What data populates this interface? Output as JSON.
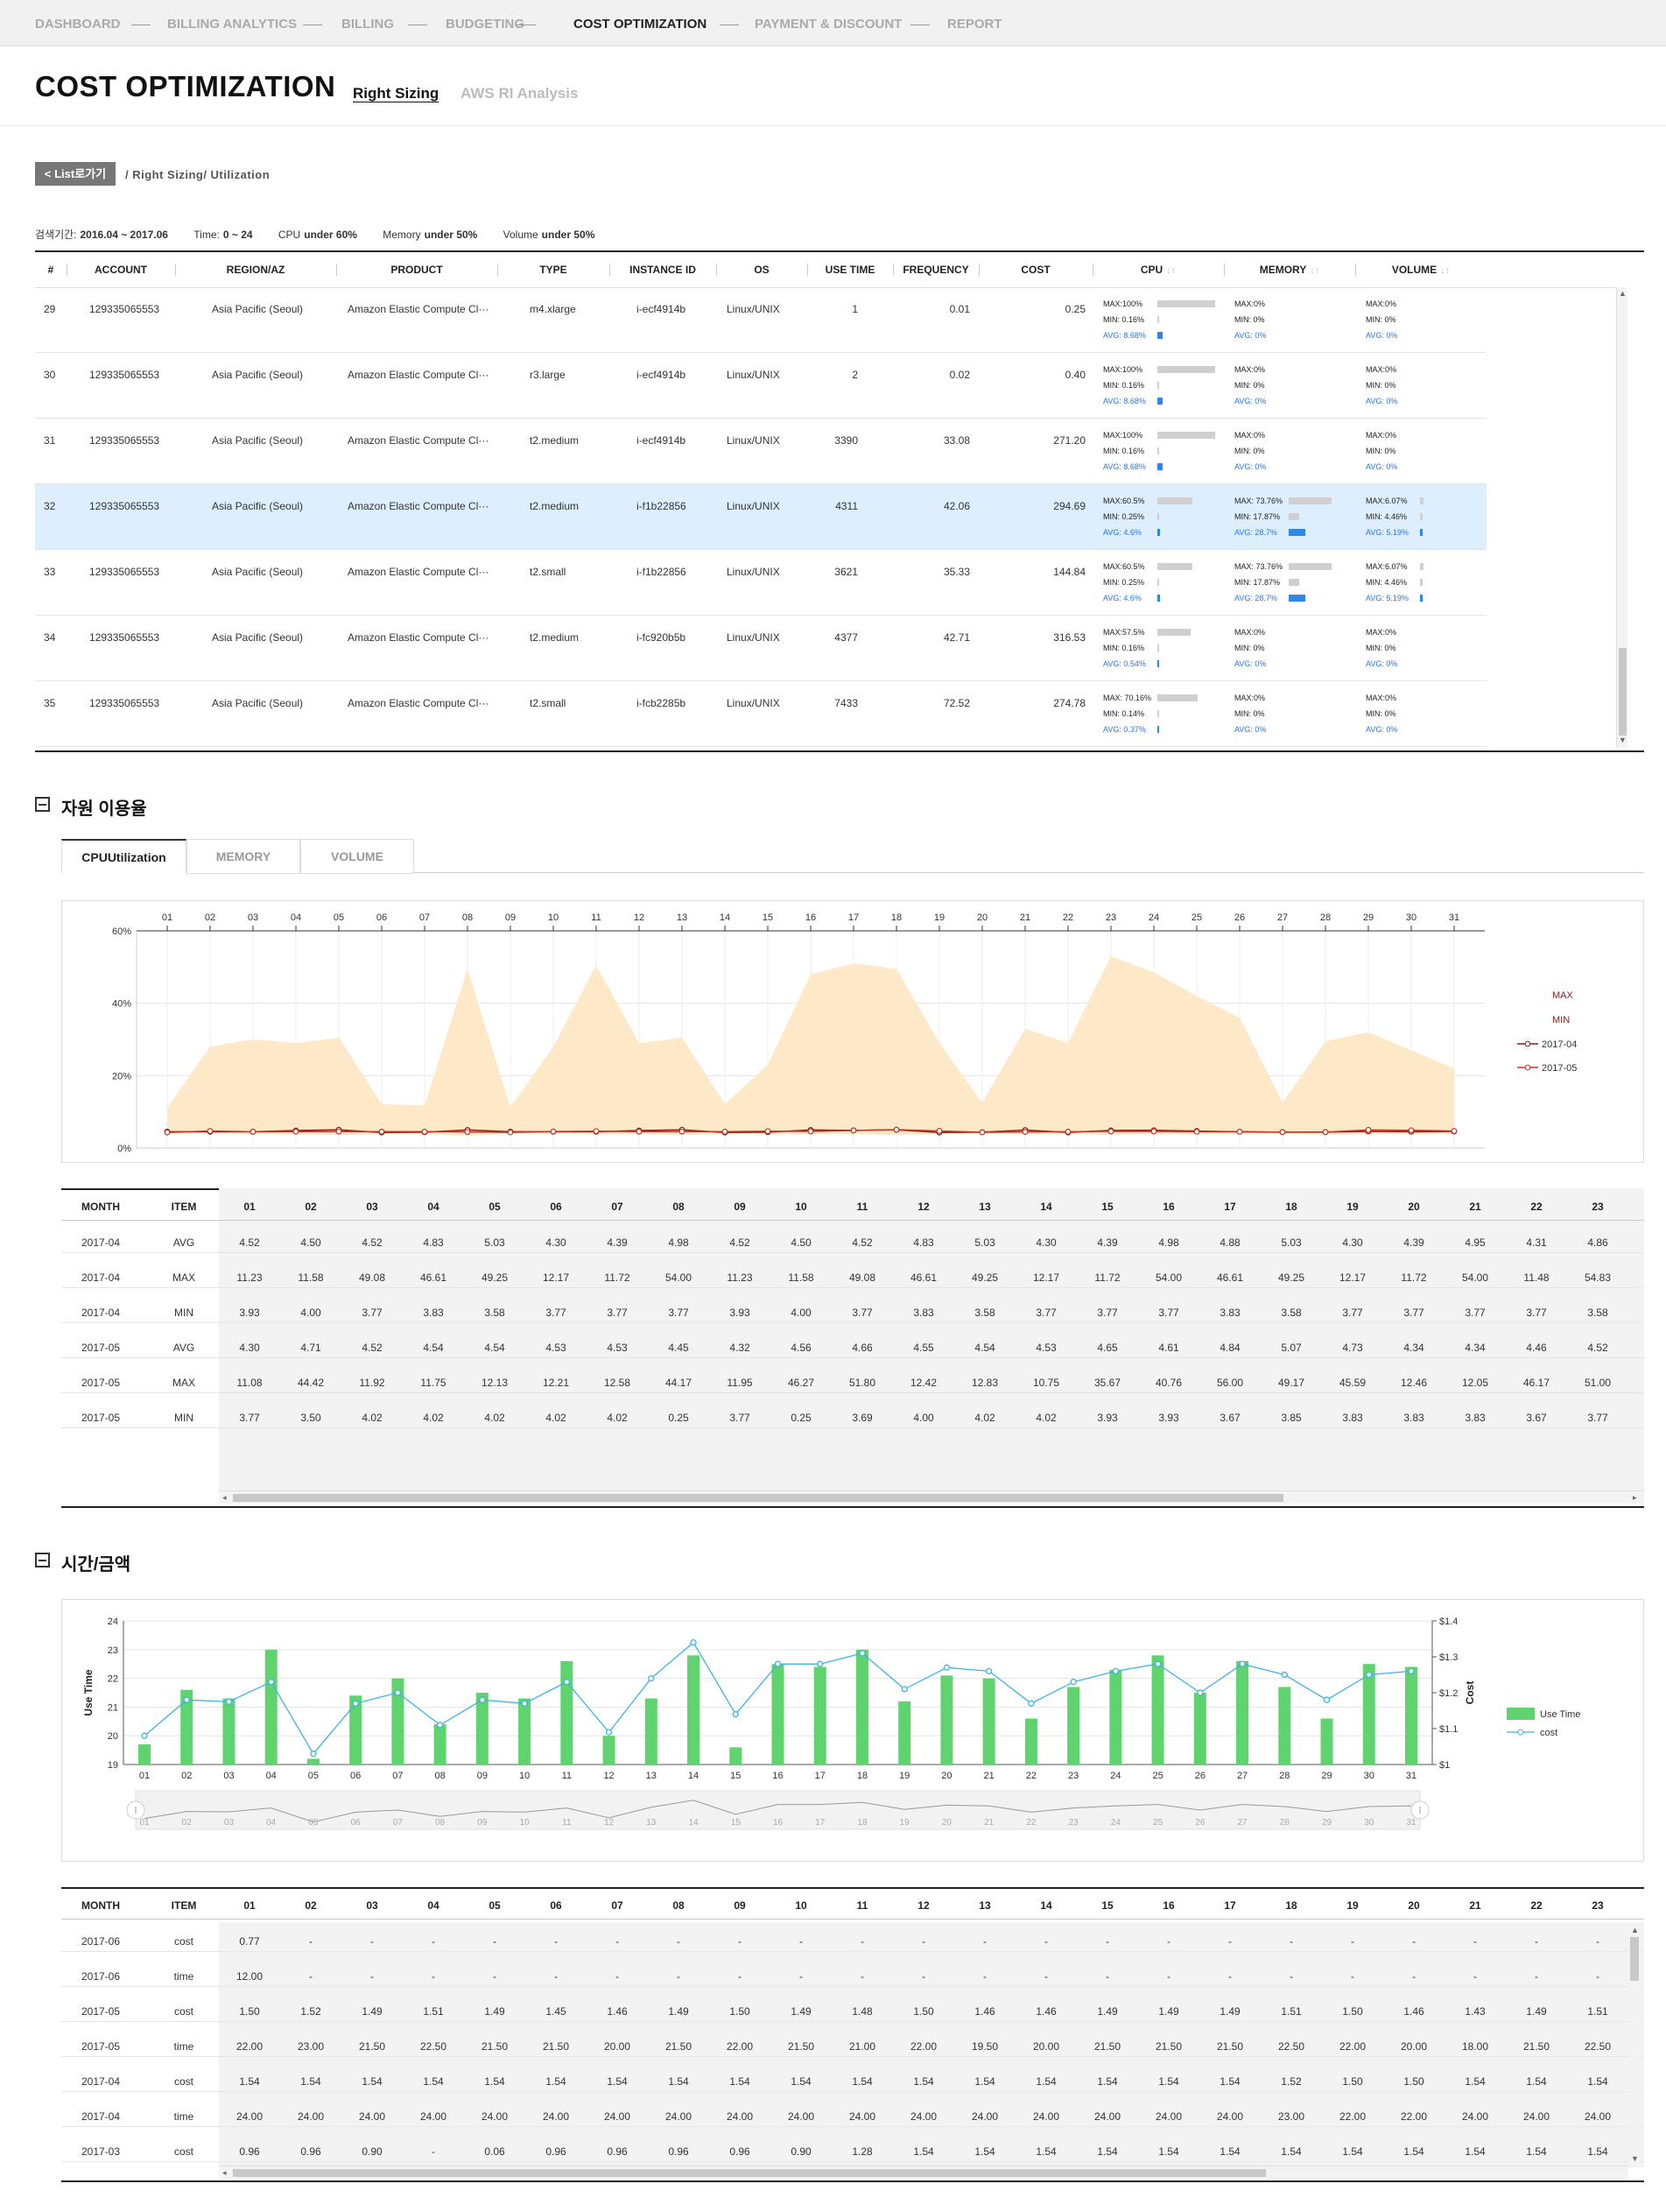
{
  "nav": {
    "items": [
      "DASHBOARD",
      "BILLING ANALYTICS",
      "BILLING",
      "BUDGETING",
      "COST OPTIMIZATION",
      "PAYMENT & DISCOUNT",
      "REPORT"
    ],
    "active_index": 4
  },
  "page": {
    "title": "COST OPTIMIZATION",
    "subtabs": [
      "Right Sizing",
      "AWS RI Analysis"
    ],
    "active_subtab": 0,
    "back_label": "< List로가기",
    "breadcrumb": "/ Right Sizing/ Utilization"
  },
  "filters": [
    {
      "label": "검색기간:",
      "value": "2016.04 ~ 2017.06"
    },
    {
      "label": "Time:",
      "value": "0 ~ 24"
    },
    {
      "label": "CPU",
      "value": "under 60%"
    },
    {
      "label": "Memory",
      "value": "under 50%"
    },
    {
      "label": "Volume",
      "value": "under 50%"
    }
  ],
  "instance_table": {
    "headers": [
      "#",
      "ACCOUNT",
      "REGION/AZ",
      "PRODUCT",
      "TYPE",
      "INSTANCE ID",
      "OS",
      "USE TIME",
      "FREQUENCY",
      "COST",
      "CPU",
      "MEMORY",
      "VOLUME"
    ],
    "sort_glyph": "↓↑",
    "selected_row": 3,
    "rows": [
      {
        "no": "29",
        "account": "129335065553",
        "region": "Asia Pacific (Seoul)",
        "product": "Amazon Elastic Compute Cl···",
        "type": "m4.xlarge",
        "instance": "i-ecf4914b",
        "os": "Linux/UNIX",
        "use_time": "1",
        "frequency": "0.01",
        "cost": "0.25",
        "cpu": {
          "max": "MAX:100%",
          "min": "MIN: 0.16%",
          "avg": "AVG: 8.68%",
          "max_v": 100,
          "min_v": 0.16,
          "avg_v": 8.68
        },
        "memory": {
          "max": "MAX:0%",
          "min": "MIN: 0%",
          "avg": "AVG: 0%",
          "max_v": 0,
          "min_v": 0,
          "avg_v": 0
        },
        "volume": {
          "max": "MAX:0%",
          "min": "MIN: 0%",
          "avg": "AVG: 0%",
          "max_v": 0,
          "min_v": 0,
          "avg_v": 0
        }
      },
      {
        "no": "30",
        "account": "129335065553",
        "region": "Asia Pacific (Seoul)",
        "product": "Amazon Elastic Compute Cl···",
        "type": "r3.large",
        "instance": "i-ecf4914b",
        "os": "Linux/UNIX",
        "use_time": "2",
        "frequency": "0.02",
        "cost": "0.40",
        "cpu": {
          "max": "MAX:100%",
          "min": "MIN: 0.16%",
          "avg": "AVG: 8.68%",
          "max_v": 100,
          "min_v": 0.16,
          "avg_v": 8.68
        },
        "memory": {
          "max": "MAX:0%",
          "min": "MIN: 0%",
          "avg": "AVG: 0%",
          "max_v": 0,
          "min_v": 0,
          "avg_v": 0
        },
        "volume": {
          "max": "MAX:0%",
          "min": "MIN: 0%",
          "avg": "AVG: 0%",
          "max_v": 0,
          "min_v": 0,
          "avg_v": 0
        }
      },
      {
        "no": "31",
        "account": "129335065553",
        "region": "Asia Pacific (Seoul)",
        "product": "Amazon Elastic Compute Cl···",
        "type": "t2.medium",
        "instance": "i-ecf4914b",
        "os": "Linux/UNIX",
        "use_time": "3390",
        "frequency": "33.08",
        "cost": "271.20",
        "cpu": {
          "max": "MAX:100%",
          "min": "MIN: 0.16%",
          "avg": "AVG: 8.68%",
          "max_v": 100,
          "min_v": 0.16,
          "avg_v": 8.68
        },
        "memory": {
          "max": "MAX:0%",
          "min": "MIN: 0%",
          "avg": "AVG: 0%",
          "max_v": 0,
          "min_v": 0,
          "avg_v": 0
        },
        "volume": {
          "max": "MAX:0%",
          "min": "MIN: 0%",
          "avg": "AVG: 0%",
          "max_v": 0,
          "min_v": 0,
          "avg_v": 0
        }
      },
      {
        "no": "32",
        "account": "129335065553",
        "region": "Asia Pacific (Seoul)",
        "product": "Amazon Elastic Compute Cl···",
        "type": "t2.medium",
        "instance": "i-f1b22856",
        "os": "Linux/UNIX",
        "use_time": "4311",
        "frequency": "42.06",
        "cost": "294.69",
        "cpu": {
          "max": "MAX:60.5%",
          "min": "MIN: 0.25%",
          "avg": "AVG: 4.6%",
          "max_v": 60.5,
          "min_v": 0.25,
          "avg_v": 4.6
        },
        "memory": {
          "max": "MAX: 73.76%",
          "min": "MIN: 17.87%",
          "avg": "AVG: 28.7%",
          "max_v": 73.76,
          "min_v": 17.87,
          "avg_v": 28.7
        },
        "volume": {
          "max": "MAX:6.07%",
          "min": "MIN: 4.46%",
          "avg": "AVG: 5.19%",
          "max_v": 6.07,
          "min_v": 4.46,
          "avg_v": 5.19
        }
      },
      {
        "no": "33",
        "account": "129335065553",
        "region": "Asia Pacific (Seoul)",
        "product": "Amazon Elastic Compute Cl···",
        "type": "t2.small",
        "instance": "i-f1b22856",
        "os": "Linux/UNIX",
        "use_time": "3621",
        "frequency": "35.33",
        "cost": "144.84",
        "cpu": {
          "max": "MAX:60.5%",
          "min": "MIN: 0.25%",
          "avg": "AVG: 4.6%",
          "max_v": 60.5,
          "min_v": 0.25,
          "avg_v": 4.6
        },
        "memory": {
          "max": "MAX: 73.76%",
          "min": "MIN: 17.87%",
          "avg": "AVG: 28.7%",
          "max_v": 73.76,
          "min_v": 17.87,
          "avg_v": 28.7
        },
        "volume": {
          "max": "MAX:6.07%",
          "min": "MIN: 4.46%",
          "avg": "AVG: 5.19%",
          "max_v": 6.07,
          "min_v": 4.46,
          "avg_v": 5.19
        }
      },
      {
        "no": "34",
        "account": "129335065553",
        "region": "Asia Pacific (Seoul)",
        "product": "Amazon Elastic Compute Cl···",
        "type": "t2.medium",
        "instance": "i-fc920b5b",
        "os": "Linux/UNIX",
        "use_time": "4377",
        "frequency": "42.71",
        "cost": "316.53",
        "cpu": {
          "max": "MAX:57.5%",
          "min": "MIN: 0.16%",
          "avg": "AVG: 0.54%",
          "max_v": 57.5,
          "min_v": 0.16,
          "avg_v": 0.54
        },
        "memory": {
          "max": "MAX:0%",
          "min": "MIN: 0%",
          "avg": "AVG: 0%",
          "max_v": 0,
          "min_v": 0,
          "avg_v": 0
        },
        "volume": {
          "max": "MAX:0%",
          "min": "MIN: 0%",
          "avg": "AVG: 0%",
          "max_v": 0,
          "min_v": 0,
          "avg_v": 0
        }
      },
      {
        "no": "35",
        "account": "129335065553",
        "region": "Asia Pacific (Seoul)",
        "product": "Amazon Elastic Compute Cl···",
        "type": "t2.small",
        "instance": "i-fcb2285b",
        "os": "Linux/UNIX",
        "use_time": "7433",
        "frequency": "72.52",
        "cost": "274.78",
        "cpu": {
          "max": "MAX: 70.16%",
          "min": "MIN: 0.14%",
          "avg": "AVG: 0.37%",
          "max_v": 70.16,
          "min_v": 0.14,
          "avg_v": 0.37
        },
        "memory": {
          "max": "MAX:0%",
          "min": "MIN: 0%",
          "avg": "AVG: 0%",
          "max_v": 0,
          "min_v": 0,
          "avg_v": 0
        },
        "volume": {
          "max": "MAX:0%",
          "min": "MIN: 0%",
          "avg": "AVG: 0%",
          "max_v": 0,
          "min_v": 0,
          "avg_v": 0
        }
      }
    ]
  },
  "usage_section": {
    "title": "자원 이용율",
    "tabs": [
      "CPUUtilization",
      "MEMORY",
      "VOLUME"
    ],
    "active_tab": 0
  },
  "time_cost_section": {
    "title": "시간/금액"
  },
  "chart_data": [
    {
      "type": "area",
      "x": [
        "01",
        "02",
        "03",
        "04",
        "05",
        "06",
        "07",
        "08",
        "09",
        "10",
        "11",
        "12",
        "13",
        "14",
        "15",
        "16",
        "17",
        "18",
        "19",
        "20",
        "21",
        "22",
        "23",
        "24",
        "25",
        "26",
        "27",
        "28",
        "29",
        "30",
        "31"
      ],
      "ylim": [
        0,
        60
      ],
      "yticks": [
        "0%",
        "20%",
        "40%",
        "60%"
      ],
      "grid": true,
      "legend": [
        "MAX",
        "MIN",
        "2017-04",
        "2017-05"
      ],
      "legend_position": "right",
      "series": [
        {
          "name": "MAX",
          "values": [
            11.23,
            28,
            30,
            29,
            30.5,
            12.17,
            11.72,
            49.5,
            11.23,
            28,
            50.5,
            29,
            30.5,
            12.17,
            23,
            48,
            51,
            49.5,
            29,
            12.5,
            33,
            29,
            53,
            48.5,
            42,
            36,
            12.5,
            29.5,
            32,
            27,
            22
          ]
        },
        {
          "name": "MIN",
          "values": [
            3.9,
            4.0,
            3.8,
            3.8,
            3.6,
            3.8,
            3.8,
            3.4,
            3.9,
            4.0,
            3.8,
            3.8,
            3.6,
            3.8,
            3.8,
            3.8,
            3.8,
            3.6,
            3.8,
            3.8,
            3.8,
            3.8,
            3.6,
            3.8,
            3.8,
            3.8,
            3.8,
            3.6,
            3.8,
            3.8,
            3.8
          ]
        },
        {
          "name": "2017-04",
          "values": [
            4.52,
            4.5,
            4.52,
            4.83,
            5.03,
            4.3,
            4.39,
            4.98,
            4.52,
            4.5,
            4.52,
            4.83,
            5.03,
            4.3,
            4.39,
            4.98,
            4.88,
            5.03,
            4.3,
            4.39,
            4.95,
            4.31,
            4.86,
            4.9,
            4.7,
            4.5,
            4.4,
            4.4,
            4.6,
            4.5,
            4.6
          ]
        },
        {
          "name": "2017-05",
          "values": [
            4.3,
            4.71,
            4.52,
            4.54,
            4.54,
            4.53,
            4.53,
            4.45,
            4.32,
            4.56,
            4.66,
            4.55,
            4.54,
            4.53,
            4.65,
            4.61,
            4.84,
            5.07,
            4.73,
            4.34,
            4.46,
            4.52,
            4.6,
            4.6,
            4.5,
            4.5,
            4.4,
            4.4,
            5.0,
            4.9,
            4.7
          ]
        }
      ]
    },
    {
      "type": "bar",
      "x": [
        "01",
        "02",
        "03",
        "04",
        "05",
        "06",
        "07",
        "08",
        "09",
        "10",
        "11",
        "12",
        "13",
        "14",
        "15",
        "16",
        "17",
        "18",
        "19",
        "20",
        "21",
        "22",
        "23",
        "24",
        "25",
        "26",
        "27",
        "28",
        "29",
        "30",
        "31"
      ],
      "ylabel": "Use Time",
      "y2label": "Cost",
      "ylim": [
        19,
        24
      ],
      "y2lim": [
        1.0,
        1.4
      ],
      "y2ticks": [
        "$1",
        "$1.1",
        "$1.2",
        "$1.3",
        "$1.4"
      ],
      "grid": true,
      "legend": [
        "Use Time",
        "cost"
      ],
      "legend_position": "right",
      "series": [
        {
          "name": "Use Time",
          "axis": "left",
          "values": [
            19.7,
            21.6,
            21.3,
            23.0,
            19.2,
            21.4,
            22.0,
            20.4,
            21.5,
            21.3,
            22.6,
            20.0,
            21.3,
            22.8,
            19.6,
            22.5,
            22.4,
            23.0,
            21.2,
            22.1,
            22.0,
            20.6,
            21.7,
            22.3,
            22.8,
            21.5,
            22.6,
            21.7,
            20.6,
            22.5,
            22.4
          ]
        },
        {
          "name": "cost",
          "axis": "right",
          "values": [
            1.08,
            1.18,
            1.175,
            1.23,
            1.03,
            1.17,
            1.2,
            1.11,
            1.18,
            1.17,
            1.23,
            1.09,
            1.24,
            1.34,
            1.14,
            1.28,
            1.28,
            1.31,
            1.21,
            1.27,
            1.26,
            1.17,
            1.23,
            1.26,
            1.28,
            1.2,
            1.28,
            1.25,
            1.18,
            1.25,
            1.26
          ]
        }
      ]
    }
  ],
  "usage_table": {
    "headers": [
      "MONTH",
      "ITEM",
      "01",
      "02",
      "03",
      "04",
      "05",
      "06",
      "07",
      "08",
      "09",
      "10",
      "11",
      "12",
      "13",
      "14",
      "15",
      "16",
      "17",
      "18",
      "19",
      "20",
      "21",
      "22",
      "23"
    ],
    "rows": [
      [
        "2017-04",
        "AVG",
        "4.52",
        "4.50",
        "4.52",
        "4.83",
        "5.03",
        "4.30",
        "4.39",
        "4.98",
        "4.52",
        "4.50",
        "4.52",
        "4.83",
        "5.03",
        "4.30",
        "4.39",
        "4.98",
        "4.88",
        "5.03",
        "4.30",
        "4.39",
        "4.95",
        "4.31",
        "4.86"
      ],
      [
        "2017-04",
        "MAX",
        "11.23",
        "11.58",
        "49.08",
        "46.61",
        "49.25",
        "12.17",
        "11.72",
        "54.00",
        "11.23",
        "11.58",
        "49.08",
        "46.61",
        "49.25",
        "12.17",
        "11.72",
        "54.00",
        "46.61",
        "49.25",
        "12.17",
        "11.72",
        "54.00",
        "11.48",
        "54.83"
      ],
      [
        "2017-04",
        "MIN",
        "3.93",
        "4.00",
        "3.77",
        "3.83",
        "3.58",
        "3.77",
        "3.77",
        "3.77",
        "3.93",
        "4.00",
        "3.77",
        "3.83",
        "3.58",
        "3.77",
        "3.77",
        "3.77",
        "3.83",
        "3.58",
        "3.77",
        "3.77",
        "3.77",
        "3.77",
        "3.58"
      ],
      [
        "2017-05",
        "AVG",
        "4.30",
        "4.71",
        "4.52",
        "4.54",
        "4.54",
        "4.53",
        "4.53",
        "4.45",
        "4.32",
        "4.56",
        "4.66",
        "4.55",
        "4.54",
        "4.53",
        "4.65",
        "4.61",
        "4.84",
        "5.07",
        "4.73",
        "4.34",
        "4.34",
        "4.46",
        "4.52"
      ],
      [
        "2017-05",
        "MAX",
        "11.08",
        "44.42",
        "11.92",
        "11.75",
        "12.13",
        "12.21",
        "12.58",
        "44.17",
        "11.95",
        "46.27",
        "51.80",
        "12.42",
        "12.83",
        "10.75",
        "35.67",
        "40.76",
        "56.00",
        "49.17",
        "45.59",
        "12.46",
        "12.05",
        "46.17",
        "51.00"
      ],
      [
        "2017-05",
        "MIN",
        "3.77",
        "3.50",
        "4.02",
        "4.02",
        "4.02",
        "4.02",
        "4.02",
        "0.25",
        "3.77",
        "0.25",
        "3.69",
        "4.00",
        "4.02",
        "4.02",
        "3.93",
        "3.93",
        "3.67",
        "3.85",
        "3.83",
        "3.83",
        "3.83",
        "3.67",
        "3.77"
      ]
    ]
  },
  "cost_table": {
    "headers": [
      "MONTH",
      "ITEM",
      "01",
      "02",
      "03",
      "04",
      "05",
      "06",
      "07",
      "08",
      "09",
      "10",
      "11",
      "12",
      "13",
      "14",
      "15",
      "16",
      "17",
      "18",
      "19",
      "20",
      "21",
      "22",
      "23"
    ],
    "rows": [
      [
        "2017-06",
        "cost",
        "0.77",
        "-",
        "-",
        "-",
        "-",
        "-",
        "-",
        "-",
        "-",
        "-",
        "-",
        "-",
        "-",
        "-",
        "-",
        "-",
        "-",
        "-",
        "-",
        "-",
        "-",
        "-",
        "-"
      ],
      [
        "2017-06",
        "time",
        "12.00",
        "-",
        "-",
        "-",
        "-",
        "-",
        "-",
        "-",
        "-",
        "-",
        "-",
        "-",
        "-",
        "-",
        "-",
        "-",
        "-",
        "-",
        "-",
        "-",
        "-",
        "-",
        "-"
      ],
      [
        "2017-05",
        "cost",
        "1.50",
        "1.52",
        "1.49",
        "1.51",
        "1.49",
        "1.45",
        "1.46",
        "1.49",
        "1.50",
        "1.49",
        "1.48",
        "1.50",
        "1.46",
        "1.46",
        "1.49",
        "1.49",
        "1.49",
        "1.51",
        "1.50",
        "1.46",
        "1.43",
        "1.49",
        "1.51"
      ],
      [
        "2017-05",
        "time",
        "22.00",
        "23.00",
        "21.50",
        "22.50",
        "21.50",
        "21.50",
        "20.00",
        "21.50",
        "22.00",
        "21.50",
        "21.00",
        "22.00",
        "19.50",
        "20.00",
        "21.50",
        "21.50",
        "21.50",
        "22.50",
        "22.00",
        "20.00",
        "18.00",
        "21.50",
        "22.50"
      ],
      [
        "2017-04",
        "cost",
        "1.54",
        "1.54",
        "1.54",
        "1.54",
        "1.54",
        "1.54",
        "1.54",
        "1.54",
        "1.54",
        "1.54",
        "1.54",
        "1.54",
        "1.54",
        "1.54",
        "1.54",
        "1.54",
        "1.54",
        "1.52",
        "1.50",
        "1.50",
        "1.54",
        "1.54",
        "1.54"
      ],
      [
        "2017-04",
        "time",
        "24.00",
        "24.00",
        "24.00",
        "24.00",
        "24.00",
        "24.00",
        "24.00",
        "24.00",
        "24.00",
        "24.00",
        "24.00",
        "24.00",
        "24.00",
        "24.00",
        "24.00",
        "24.00",
        "24.00",
        "23.00",
        "22.00",
        "22.00",
        "24.00",
        "24.00",
        "24.00"
      ],
      [
        "2017-03",
        "cost",
        "0.96",
        "0.96",
        "0.90",
        "-",
        "0.06",
        "0.96",
        "0.96",
        "0.96",
        "0.96",
        "0.90",
        "1.28",
        "1.54",
        "1.54",
        "1.54",
        "1.54",
        "1.54",
        "1.54",
        "1.54",
        "1.54",
        "1.54",
        "1.54",
        "1.54",
        "1.54"
      ]
    ]
  },
  "colors": {
    "max_area": "#fde8c8",
    "series_2017_04": "#8b1a1a",
    "series_2017_05": "#c0392b",
    "use_time_bar": "#5fd36e",
    "cost_line": "#3db4e3",
    "selected_row": "#ddeeff",
    "avg_text": "#2277ee"
  }
}
